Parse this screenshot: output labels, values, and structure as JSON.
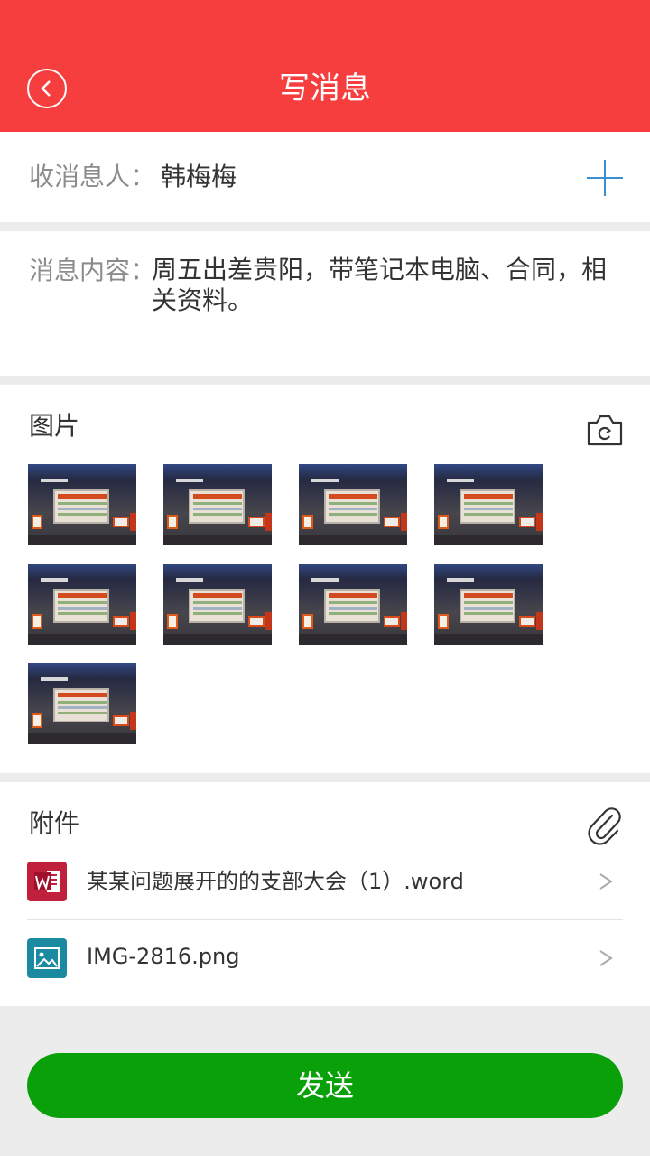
{
  "header": {
    "title": "写消息",
    "bg_color": "#f63e3e"
  },
  "recipient": {
    "label": "收消息人：",
    "value": "韩梅梅"
  },
  "content": {
    "label": "消息内容：",
    "value": "周五出差贵阳，带笔记本电脑、合同，相关资料。"
  },
  "images": {
    "title": "图片",
    "count": 9
  },
  "attachments": {
    "title": "附件",
    "files": [
      {
        "name": "某某问题展开的的支部大会（1）.word",
        "icon": "word-file-icon",
        "color": "#c0203c"
      },
      {
        "name": "IMG-2816.png",
        "icon": "image-file-icon",
        "color": "#1a8aa0"
      }
    ]
  },
  "send_button": {
    "label": "发送",
    "color": "#0aa00a"
  }
}
